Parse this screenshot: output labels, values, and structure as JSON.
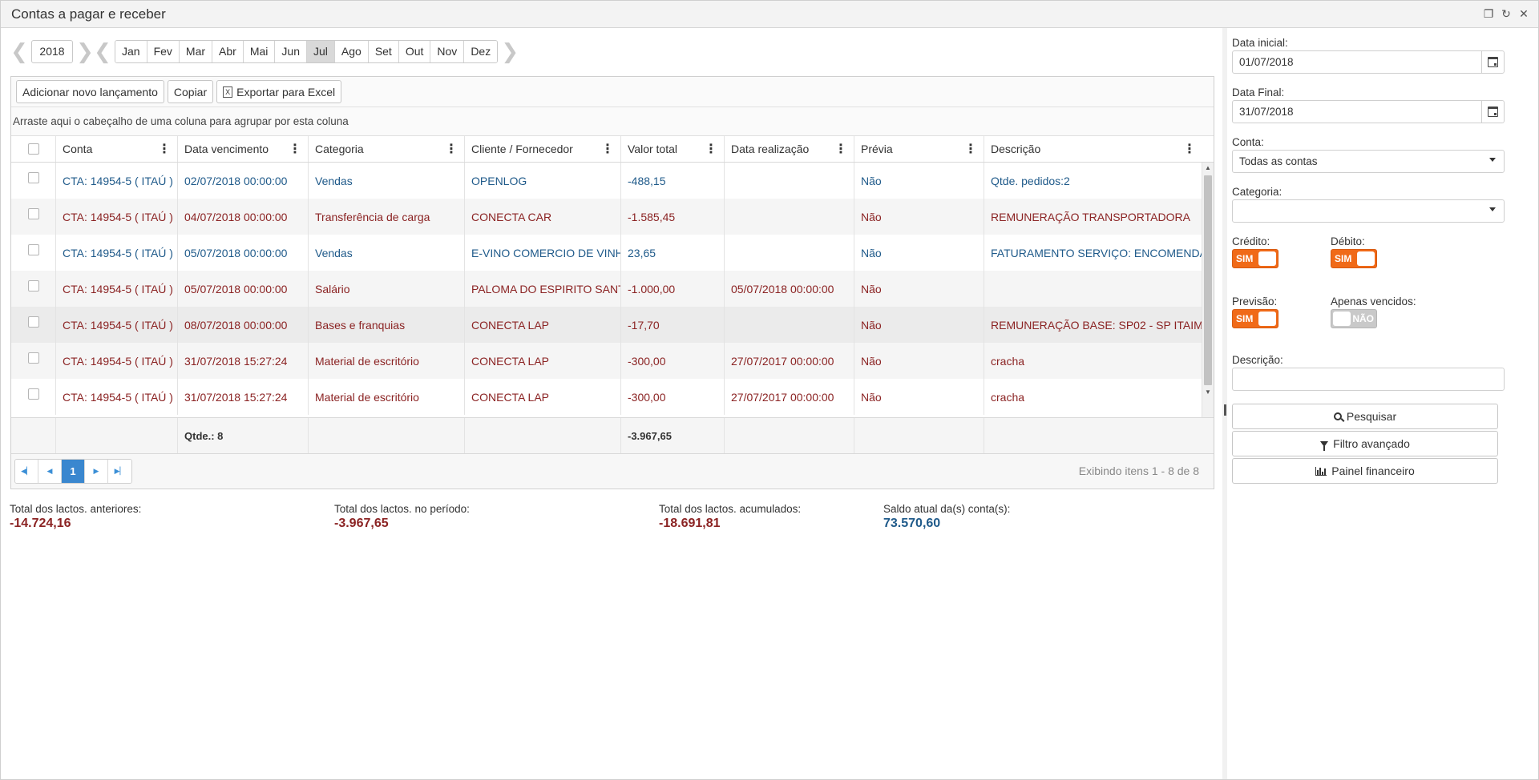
{
  "window": {
    "title": "Contas a pagar e receber"
  },
  "calendar": {
    "year": "2018",
    "months": [
      "Jan",
      "Fev",
      "Mar",
      "Abr",
      "Mai",
      "Jun",
      "Jul",
      "Ago",
      "Set",
      "Out",
      "Nov",
      "Dez"
    ],
    "active_month": "Jul"
  },
  "toolbar": {
    "add_label": "Adicionar novo lançamento",
    "copy_label": "Copiar",
    "export_label": "Exportar para Excel"
  },
  "grid": {
    "group_hint": "Arraste aqui o cabeçalho de uma coluna para agrupar por esta coluna",
    "columns": [
      "Conta",
      "Data vencimento",
      "Categoria",
      "Cliente / Fornecedor",
      "Valor total",
      "Data realização",
      "Prévia",
      "Descrição"
    ],
    "rows": [
      {
        "type": "credit",
        "conta": "CTA: 14954-5 ( ITAÚ )",
        "vencimento": "02/07/2018 00:00:00",
        "categoria": "Vendas",
        "cliente": "OPENLOG",
        "valor": "-488,15",
        "realizacao": "",
        "previa": "Não",
        "descricao": "Qtde. pedidos:2"
      },
      {
        "type": "debit",
        "conta": "CTA: 14954-5 ( ITAÚ )",
        "vencimento": "04/07/2018 00:00:00",
        "categoria": "Transferência de carga",
        "cliente": "CONECTA CAR",
        "valor": "-1.585,45",
        "realizacao": "",
        "previa": "Não",
        "descricao": "REMUNERAÇÃO TRANSPORTADORA"
      },
      {
        "type": "credit",
        "conta": "CTA: 14954-5 ( ITAÚ )",
        "vencimento": "05/07/2018 00:00:00",
        "categoria": "Vendas",
        "cliente": "E-VINO COMERCIO DE VINHOS",
        "valor": "23,65",
        "realizacao": "",
        "previa": "Não",
        "descricao": "FATURAMENTO SERVIÇO: ENCOMENDA"
      },
      {
        "type": "debit",
        "conta": "CTA: 14954-5 ( ITAÚ )",
        "vencimento": "05/07/2018 00:00:00",
        "categoria": "Salário",
        "cliente": "PALOMA DO ESPIRITO SANTO",
        "valor": "-1.000,00",
        "realizacao": "05/07/2018 00:00:00",
        "previa": "Não",
        "descricao": ""
      },
      {
        "type": "debit",
        "conta": "CTA: 14954-5 ( ITAÚ )",
        "vencimento": "08/07/2018 00:00:00",
        "categoria": "Bases e franquias",
        "cliente": "CONECTA LAP",
        "valor": "-17,70",
        "realizacao": "",
        "previa": "Não",
        "descricao": "REMUNERAÇÃO BASE: SP02 - SP ITAIM"
      },
      {
        "type": "debit",
        "conta": "CTA: 14954-5 ( ITAÚ )",
        "vencimento": "31/07/2018 15:27:24",
        "categoria": "Material de escritório",
        "cliente": "CONECTA LAP",
        "valor": "-300,00",
        "realizacao": "27/07/2017 00:00:00",
        "previa": "Não",
        "descricao": "cracha"
      },
      {
        "type": "debit",
        "conta": "CTA: 14954-5 ( ITAÚ )",
        "vencimento": "31/07/2018 15:27:24",
        "categoria": "Material de escritório",
        "cliente": "CONECTA LAP",
        "valor": "-300,00",
        "realizacao": "27/07/2017 00:00:00",
        "previa": "Não",
        "descricao": "cracha"
      }
    ],
    "footer": {
      "qtde": "Qtde.: 8",
      "valor_total": "-3.967,65"
    },
    "pager": {
      "current_page": "1",
      "info": "Exibindo itens 1 - 8 de 8"
    }
  },
  "totals": [
    {
      "label": "Total dos lactos. anteriores:",
      "value": "-14.724,16",
      "tone": "neg"
    },
    {
      "label": "Total dos lactos. no período:",
      "value": "-3.967,65",
      "tone": "neg"
    },
    {
      "label": "Total dos lactos. acumulados:",
      "value": "-18.691,81",
      "tone": "neg"
    },
    {
      "label": "Saldo atual da(s) conta(s):",
      "value": "73.570,60",
      "tone": "pos"
    }
  ],
  "filters": {
    "data_inicial_label": "Data inicial:",
    "data_inicial": "01/07/2018",
    "data_final_label": "Data Final:",
    "data_final": "31/07/2018",
    "conta_label": "Conta:",
    "conta_value": "Todas as contas",
    "categoria_label": "Categoria:",
    "categoria_value": "",
    "credito_label": "Crédito:",
    "credito_state": "SIM",
    "debito_label": "Débito:",
    "debito_state": "SIM",
    "previsao_label": "Previsão:",
    "previsao_state": "SIM",
    "vencidos_label": "Apenas vencidos:",
    "vencidos_state": "NÃO",
    "descricao_label": "Descrição:",
    "descricao_value": "",
    "search_label": "Pesquisar",
    "advanced_label": "Filtro avançado",
    "panel_label": "Painel financeiro"
  },
  "colors": {
    "credit": "#1f5a8a",
    "debit": "#8b2323",
    "toggle_on": "#f06a18",
    "pager_active": "#3a87cf"
  }
}
